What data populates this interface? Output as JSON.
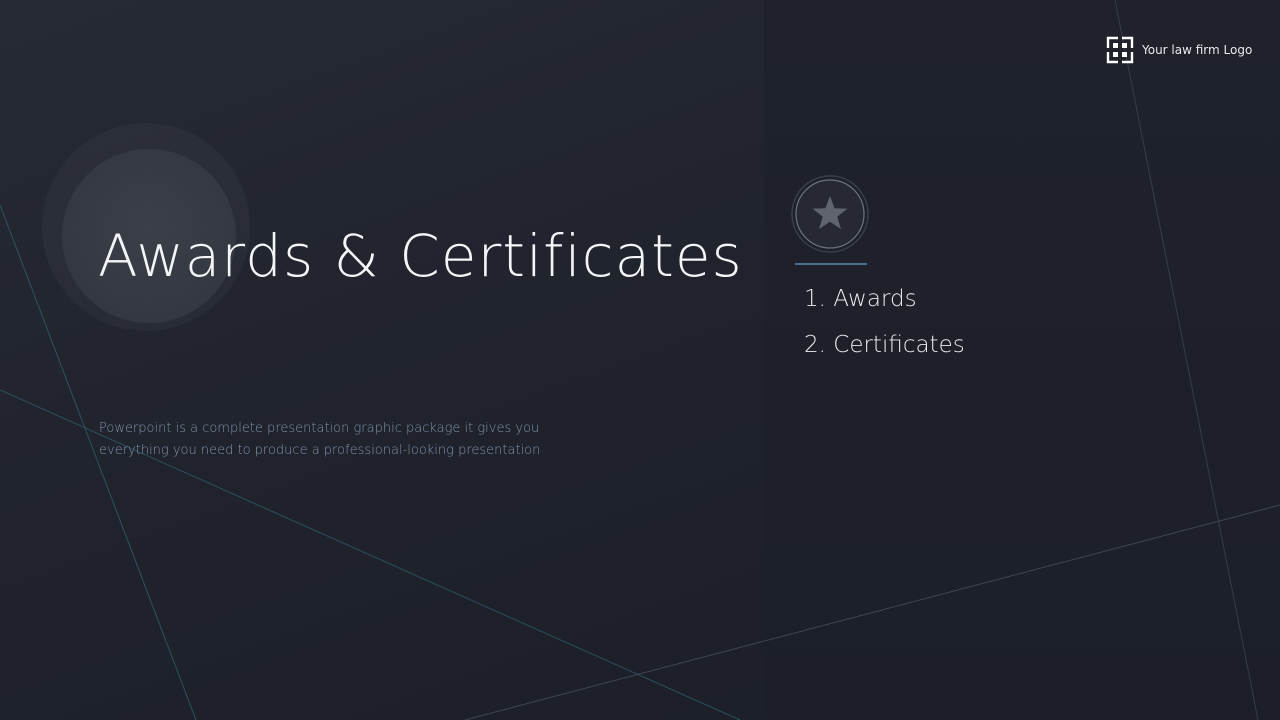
{
  "slide": {
    "title": "Awards & Certificates",
    "description": "Powerpoint is a complete presentation graphic package it gives you everything you need to produce a professional-looking presentation"
  },
  "logo": {
    "text": "Your law firm Logo",
    "icon": "law-firm-logo-icon"
  },
  "badge": {
    "icon": "star-icon"
  },
  "agenda": {
    "items": [
      {
        "label": "1. Awards"
      },
      {
        "label": "2. Certificates"
      }
    ]
  },
  "colors": {
    "background": "#20232c",
    "panel": "#1e2129",
    "accent": "#4a6d8c",
    "description_text": "#7f93ad",
    "title_text": "#f4f5f7"
  }
}
